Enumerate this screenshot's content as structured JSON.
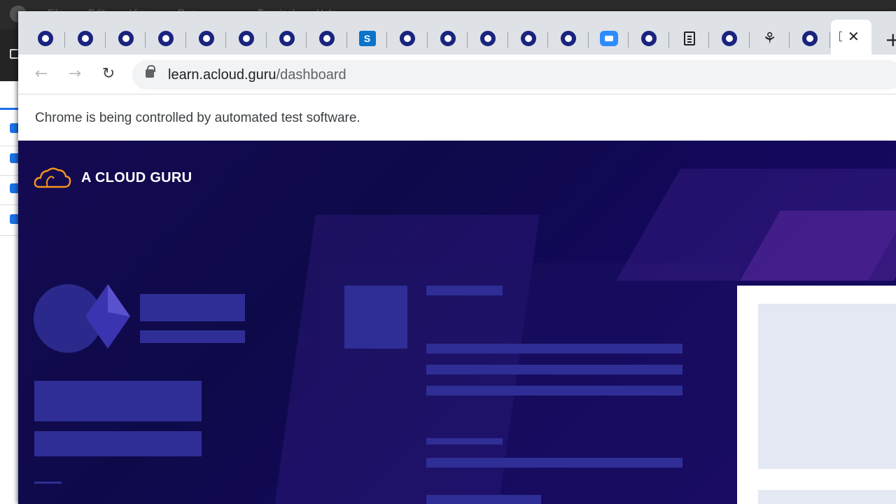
{
  "background_app": {
    "menu_items": [
      "File",
      "Edit",
      "View",
      "Run",
      "Terminal",
      "Help"
    ]
  },
  "browser": {
    "tabs": [
      {
        "icon": "ring-icon"
      },
      {
        "icon": "ring-icon"
      },
      {
        "icon": "ring-icon"
      },
      {
        "icon": "ring-icon"
      },
      {
        "icon": "ring-icon"
      },
      {
        "icon": "ring-icon"
      },
      {
        "icon": "ring-icon"
      },
      {
        "icon": "ring-icon"
      },
      {
        "icon": "sharepoint-icon",
        "glyph": "S"
      },
      {
        "icon": "ring-icon"
      },
      {
        "icon": "ring-icon"
      },
      {
        "icon": "ring-icon"
      },
      {
        "icon": "ring-icon"
      },
      {
        "icon": "ring-icon"
      },
      {
        "icon": "zoom-icon"
      },
      {
        "icon": "ring-icon"
      },
      {
        "icon": "reader-icon"
      },
      {
        "icon": "ring-icon"
      },
      {
        "icon": "tree-icon",
        "glyph": "⚘"
      },
      {
        "icon": "ring-icon"
      }
    ],
    "active_tab": {
      "close_glyph": "✕"
    },
    "new_tab_glyph": "+",
    "nav": {
      "back": "←",
      "forward": "→",
      "reload": "↻"
    },
    "url": {
      "host": "learn.acloud.guru",
      "path": "/dashboard"
    },
    "infobar": "Chrome is being controlled by automated test software.",
    "colors": {
      "ring": "#1a237e",
      "accent": "#1a73e8",
      "page_bg": "#140a52",
      "skeleton": "#2b2a8c"
    }
  },
  "page": {
    "brand": "A CLOUD GURU"
  }
}
